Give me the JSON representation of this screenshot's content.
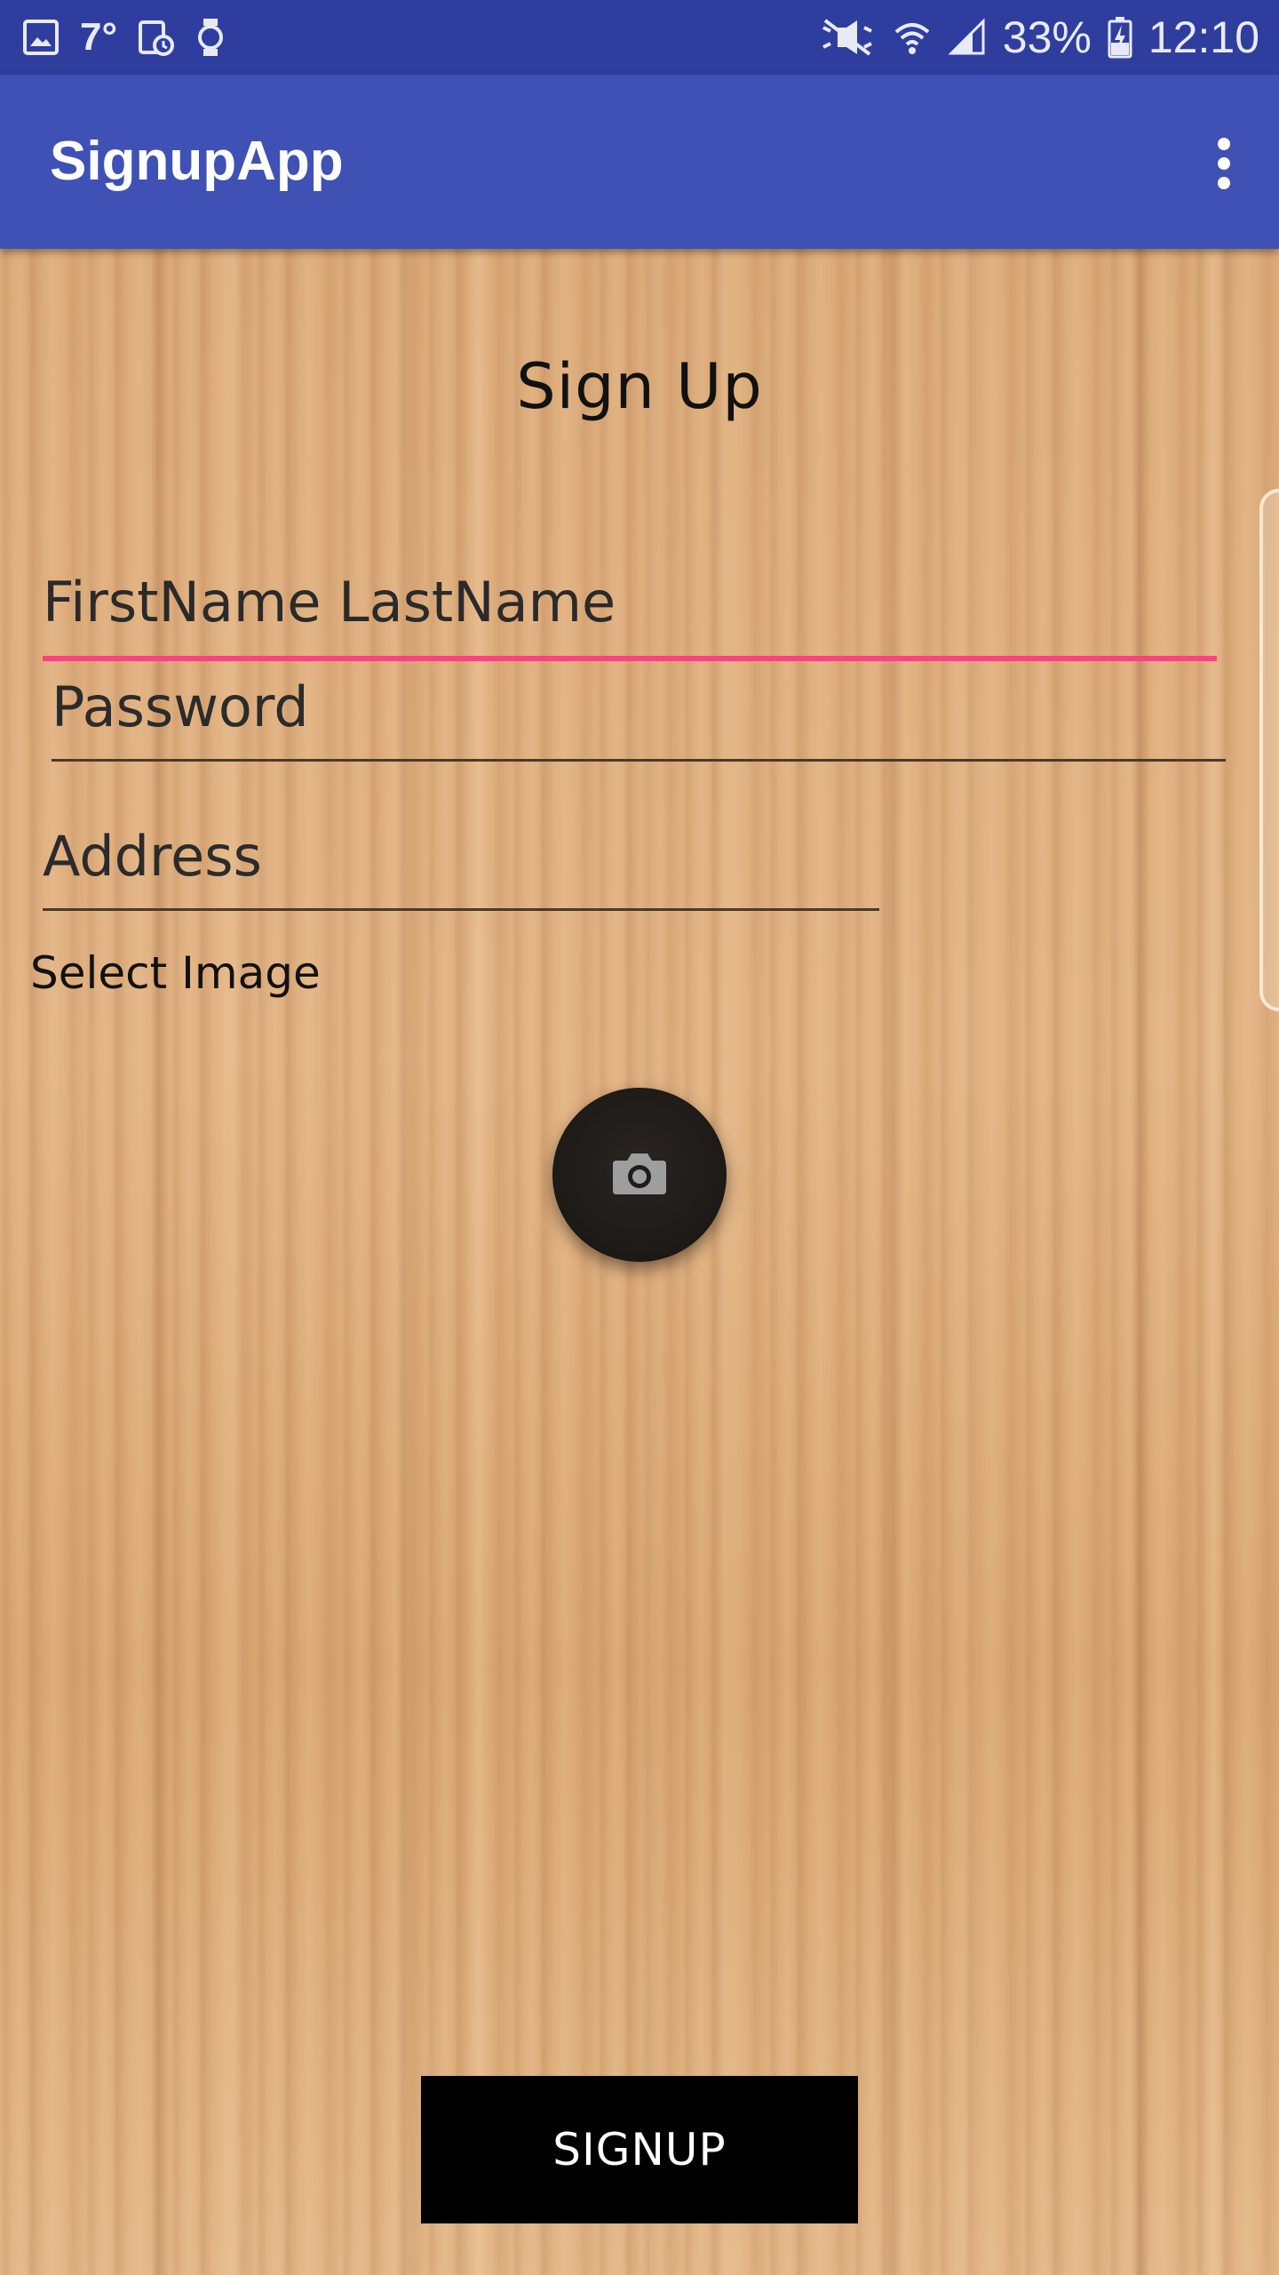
{
  "status_bar": {
    "temperature": "7°",
    "battery_percent": "33%",
    "time": "12:10",
    "icons": [
      "gallery-icon",
      "temperature-icon",
      "alarm-icon",
      "watch-icon",
      "mute-icon",
      "wifi-icon",
      "signal-icon",
      "battery-charging-icon"
    ]
  },
  "app_bar": {
    "title": "SignupApp",
    "menu_icon": "overflow-menu-icon"
  },
  "form": {
    "heading": "Sign Up",
    "name_value": "FirstName  LastName",
    "password_placeholder": "Password",
    "address_placeholder": "Address",
    "select_image_label": "Select Image",
    "camera_icon": "camera-icon",
    "signup_label": "SIGNUP"
  },
  "colors": {
    "status_bar": "#2f3e9e",
    "app_bar": "#3f51b5",
    "accent": "#ff4081",
    "button": "#000000"
  }
}
